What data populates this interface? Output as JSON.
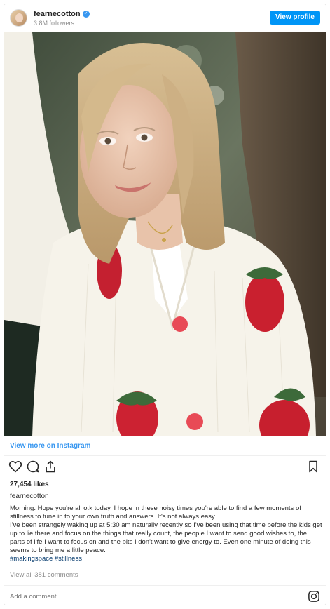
{
  "header": {
    "username": "fearnecotton",
    "verified_glyph": "✓",
    "followers": "3.8M followers",
    "view_profile_label": "View profile"
  },
  "post": {
    "image_description_icon": "photo",
    "view_more_label": "View more on Instagram",
    "likes": "27,454 likes",
    "author": "fearnecotton",
    "caption_line1": "Morning. Hope you're all o.k today. I hope in these noisy times you're able to find a few moments of stillness to tune in to your own truth and answers. It's not always easy.",
    "caption_line2": "I've been strangely waking up at 5:30 am naturally recently so I've been using that time before the kids get up to lie there and focus on the things that really count, the people I want to send good wishes to, the parts of life I want to focus on and the bits I don't want to give energy to. Even one minute of doing this seems to bring me a little peace.",
    "hashtags": "#makingspace #stillness",
    "view_comments": "View all 381 comments"
  },
  "actions": {
    "like_icon": "heart-icon",
    "comment_icon": "comment-icon",
    "share_icon": "share-icon",
    "save_icon": "bookmark-icon"
  },
  "comment_box": {
    "placeholder": "Add a comment..."
  },
  "colors": {
    "accent": "#0095f6",
    "link": "#3897f0",
    "secondary_text": "#8e8e8e"
  }
}
